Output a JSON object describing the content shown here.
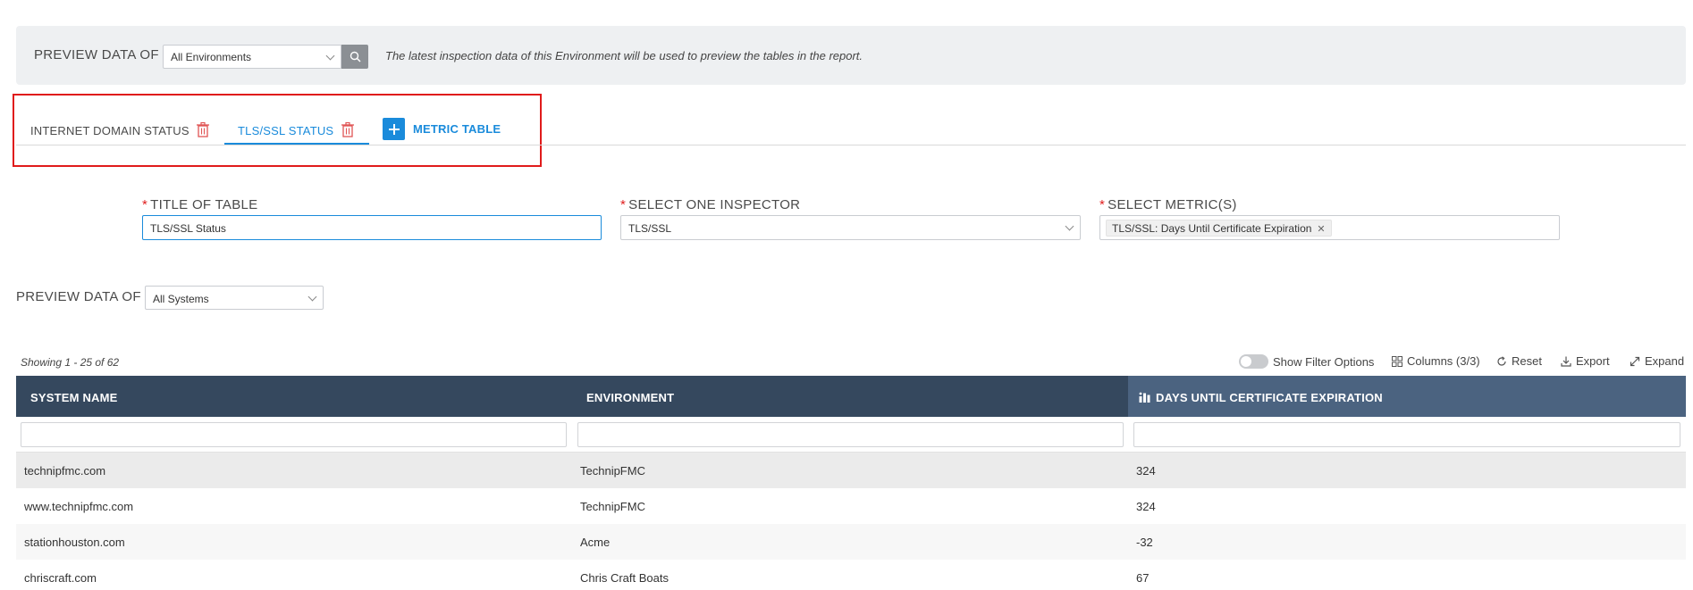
{
  "preview_env": {
    "label": "PREVIEW DATA OF",
    "selected": "All Environments",
    "note": "The latest inspection data of this Environment will be used to preview the tables in the report."
  },
  "tabs": [
    {
      "label": "INTERNET DOMAIN STATUS",
      "active": false
    },
    {
      "label": "TLS/SSL STATUS",
      "active": true
    }
  ],
  "add_metric_label": "METRIC TABLE",
  "form": {
    "title_label": "TITLE OF TABLE",
    "title_value": "TLS/SSL Status",
    "inspector_label": "SELECT ONE INSPECTOR",
    "inspector_value": "TLS/SSL",
    "metrics_label": "SELECT METRIC(S)",
    "metrics_tags": [
      "TLS/SSL: Days Until Certificate Expiration"
    ],
    "required_mark": "*"
  },
  "preview_system": {
    "label": "PREVIEW DATA OF",
    "selected": "All Systems"
  },
  "table_info": {
    "showing": "Showing 1 - 25 of 62",
    "show_filter": "Show Filter Options",
    "columns": "Columns (3/3)",
    "reset": "Reset",
    "export": "Export",
    "expand": "Expand"
  },
  "table": {
    "headers": [
      "SYSTEM NAME",
      "ENVIRONMENT",
      "DAYS UNTIL CERTIFICATE EXPIRATION"
    ],
    "rows": [
      [
        "technipfmc.com",
        "TechnipFMC",
        "324"
      ],
      [
        "www.technipfmc.com",
        "TechnipFMC",
        "324"
      ],
      [
        "stationhouston.com",
        "Acme",
        "-32"
      ],
      [
        "chriscraft.com",
        "Chris Craft Boats",
        "67"
      ]
    ]
  },
  "colors": {
    "accent": "#1a8bdb",
    "header_bg": "#35485e",
    "danger": "#e02020"
  }
}
